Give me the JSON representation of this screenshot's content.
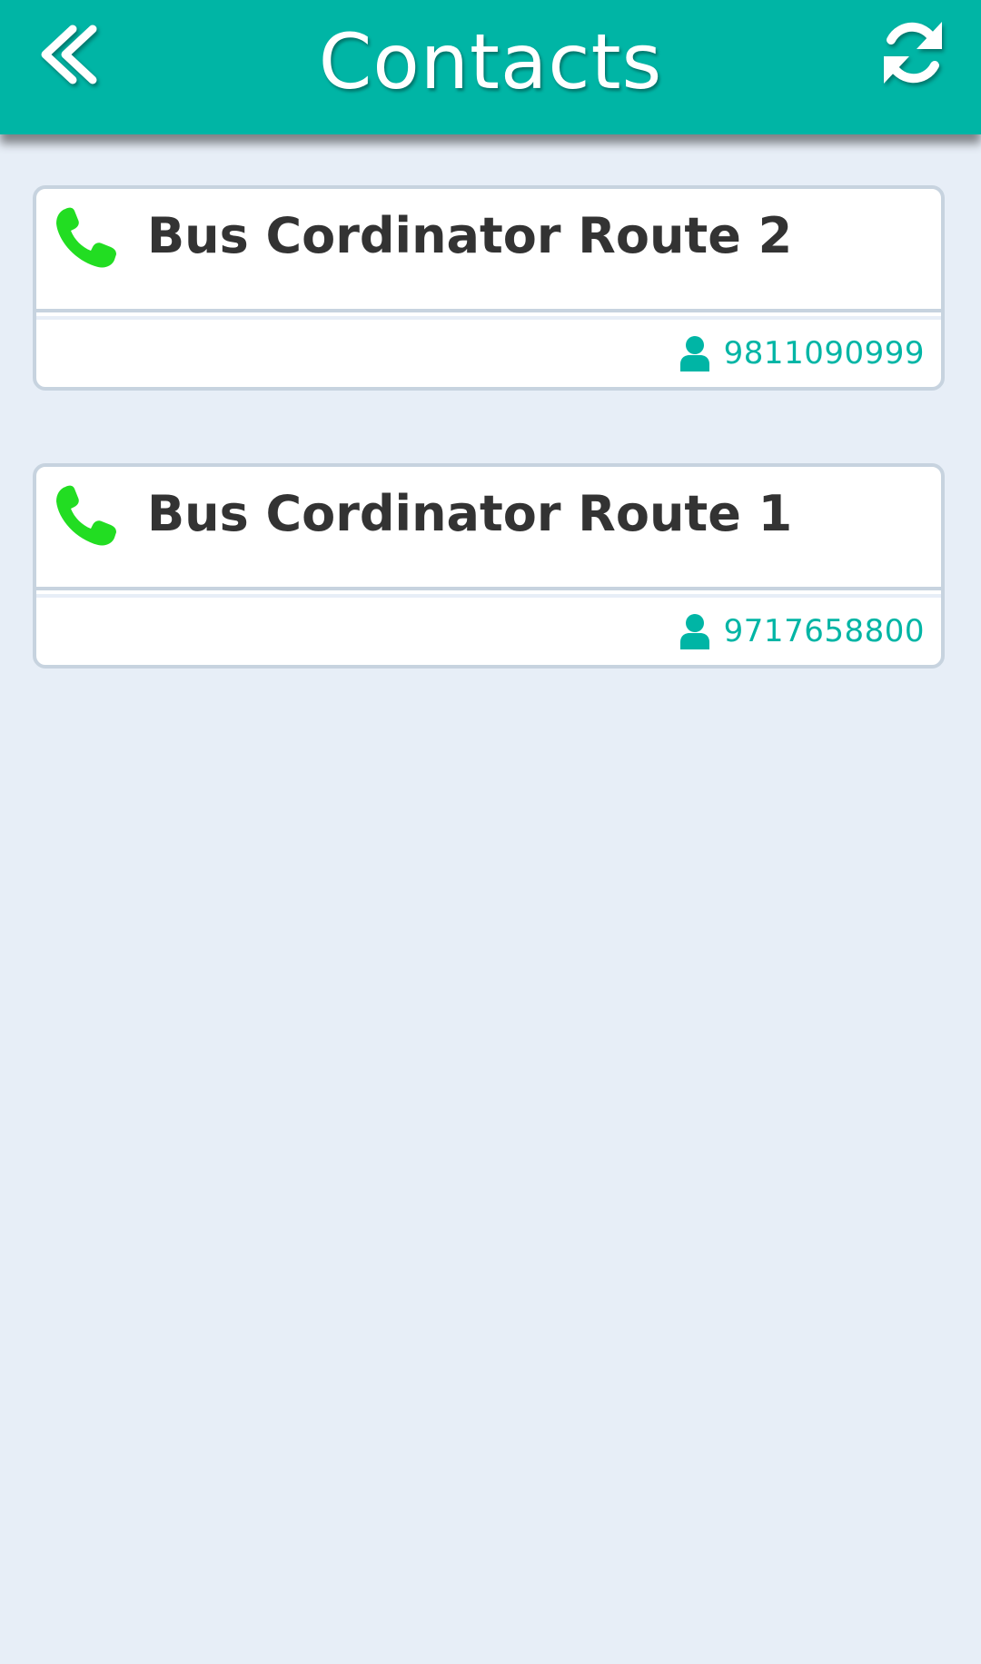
{
  "header": {
    "title": "Contacts",
    "back_icon": "double-chevron-left-icon",
    "refresh_icon": "refresh-icon",
    "background_color": "#00b5a5"
  },
  "contacts": [
    {
      "name": "Bus Cordinator Route 2",
      "phone": "9811090999",
      "call_icon": "phone-icon",
      "user_icon": "user-icon"
    },
    {
      "name": "Bus Cordinator Route 1",
      "phone": "9717658800",
      "call_icon": "phone-icon",
      "user_icon": "user-icon"
    }
  ],
  "colors": {
    "accent": "#00b5a5",
    "call_green": "#22dd22",
    "background": "#e7eef7",
    "text": "#333333"
  }
}
